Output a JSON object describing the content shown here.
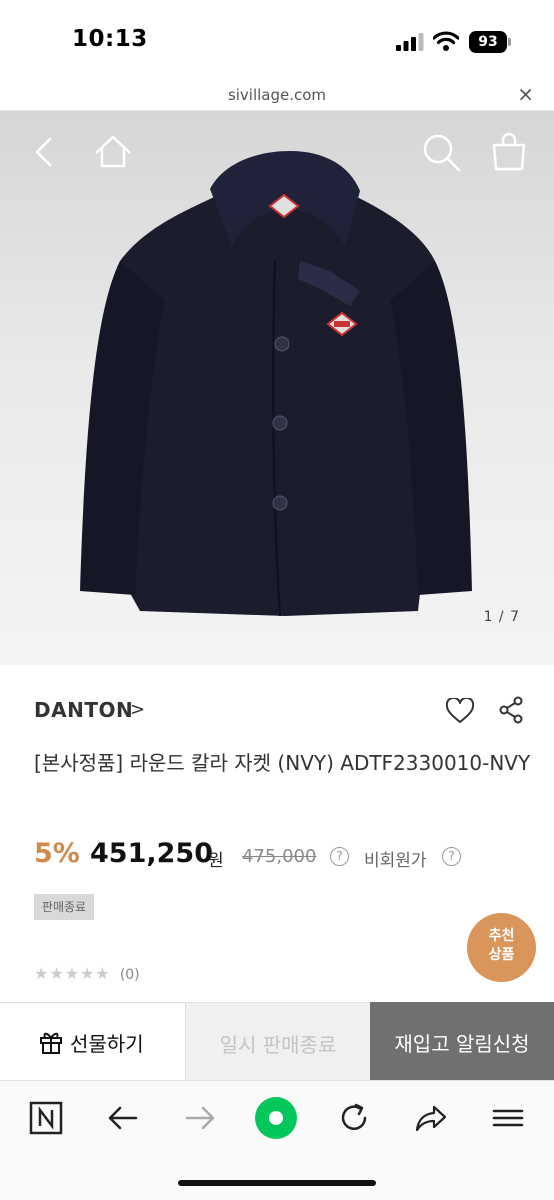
{
  "status_bar": {
    "time": "10:13",
    "battery": "93"
  },
  "url_bar": {
    "domain": "sivillage.com",
    "close": "×"
  },
  "hero": {
    "counter": "1 / 7"
  },
  "product": {
    "brand": "DANTON",
    "brand_chevron": ">",
    "name": "[본사정품] 라운드 칼라 자켓 (NVY) ADTF2330010-NVY",
    "discount": "5%",
    "price": "451,250",
    "currency": "원",
    "original_price": "475,000",
    "nonmember_label": "비회원가",
    "help_glyph": "?",
    "sold_out_badge": "판매종료",
    "rating_count": "(0)",
    "rating_value": 0,
    "rating_max": 5
  },
  "recommend": {
    "line1": "추천",
    "line2": "상품"
  },
  "actions": {
    "gift_label": "선물하기",
    "temp_soldout_label": "일시 판매종료",
    "restock_label": "재입고 알림신청"
  },
  "colors": {
    "accent_discount": "#d18a4c",
    "recommend_bg": "#d9955a",
    "restock_bg": "#707070",
    "naver_green": "#03c75a"
  },
  "icons": [
    "back-icon",
    "home-icon",
    "search-icon",
    "cart-icon",
    "heart-icon",
    "share-icon",
    "gift-icon",
    "naver-icon",
    "back-arrow-icon",
    "forward-arrow-icon",
    "reload-icon",
    "share-arrow-icon",
    "menu-icon"
  ]
}
